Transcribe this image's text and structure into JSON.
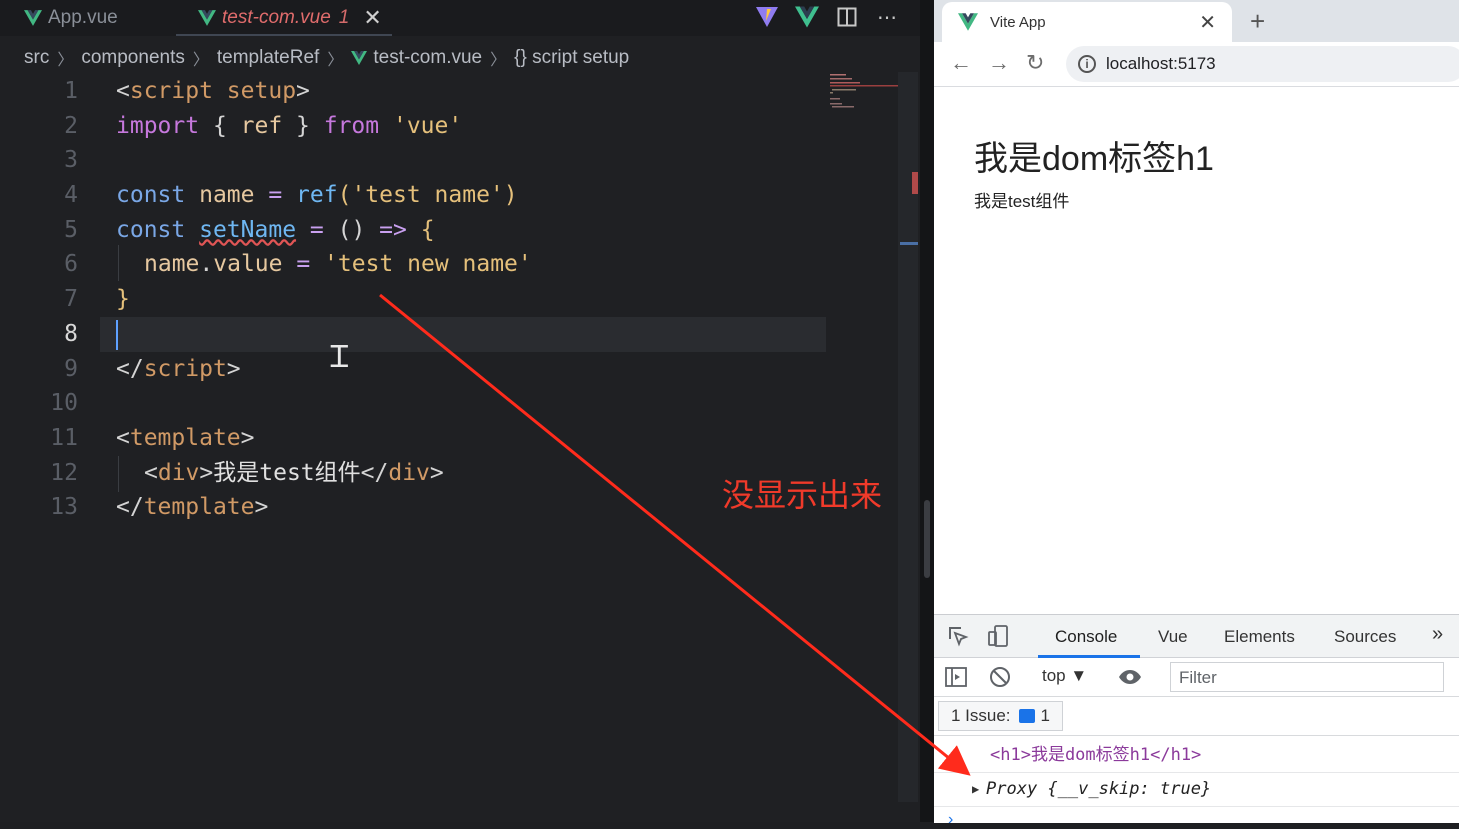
{
  "editor": {
    "tabs": [
      {
        "label": "App.vue"
      },
      {
        "label": "test-com.vue",
        "problems": "1"
      }
    ],
    "breadcrumb": [
      "src",
      "components",
      "templateRef",
      "test-com.vue",
      "{} script setup"
    ],
    "line_numbers": [
      "1",
      "2",
      "3",
      "4",
      "5",
      "6",
      "7",
      "8",
      "9",
      "10",
      "11",
      "12",
      "13"
    ],
    "active_line": "8",
    "code": {
      "l1": [
        "<",
        "script",
        " setup",
        ">"
      ],
      "l2": [
        "import",
        " { ",
        "ref",
        " } ",
        "from",
        " ",
        "'vue'"
      ],
      "l4": [
        "const",
        " ",
        "name",
        " = ",
        "ref",
        "(",
        "'test name'",
        ")"
      ],
      "l5": [
        "const",
        " ",
        "setName",
        " = ",
        "()",
        " ",
        "=>",
        " ",
        "{"
      ],
      "l6": [
        "name",
        ".",
        "value",
        " = ",
        "'test new name'"
      ],
      "l7": [
        "}"
      ],
      "l9": [
        "</",
        "script",
        ">"
      ],
      "l11": [
        "<",
        "template",
        ">"
      ],
      "l12": [
        "<",
        "div",
        ">",
        "我是test组件",
        "</",
        "div",
        ">"
      ],
      "l13": [
        "</",
        "template",
        ">"
      ]
    }
  },
  "annotation": "没显示出来",
  "browser": {
    "tab_title": "Vite App",
    "url": "localhost:5173",
    "page": {
      "h1": "我是dom标签h1",
      "div": "我是test组件"
    },
    "devtools": {
      "tabs": [
        "Console",
        "Vue",
        "Elements",
        "Sources"
      ],
      "context": "top",
      "filter_placeholder": "Filter",
      "issues_label": "1 Issue:",
      "issues_count": "1",
      "logs": [
        "<h1>我是dom标签h1</h1>",
        "Proxy {__v_skip: true}"
      ]
    }
  }
}
